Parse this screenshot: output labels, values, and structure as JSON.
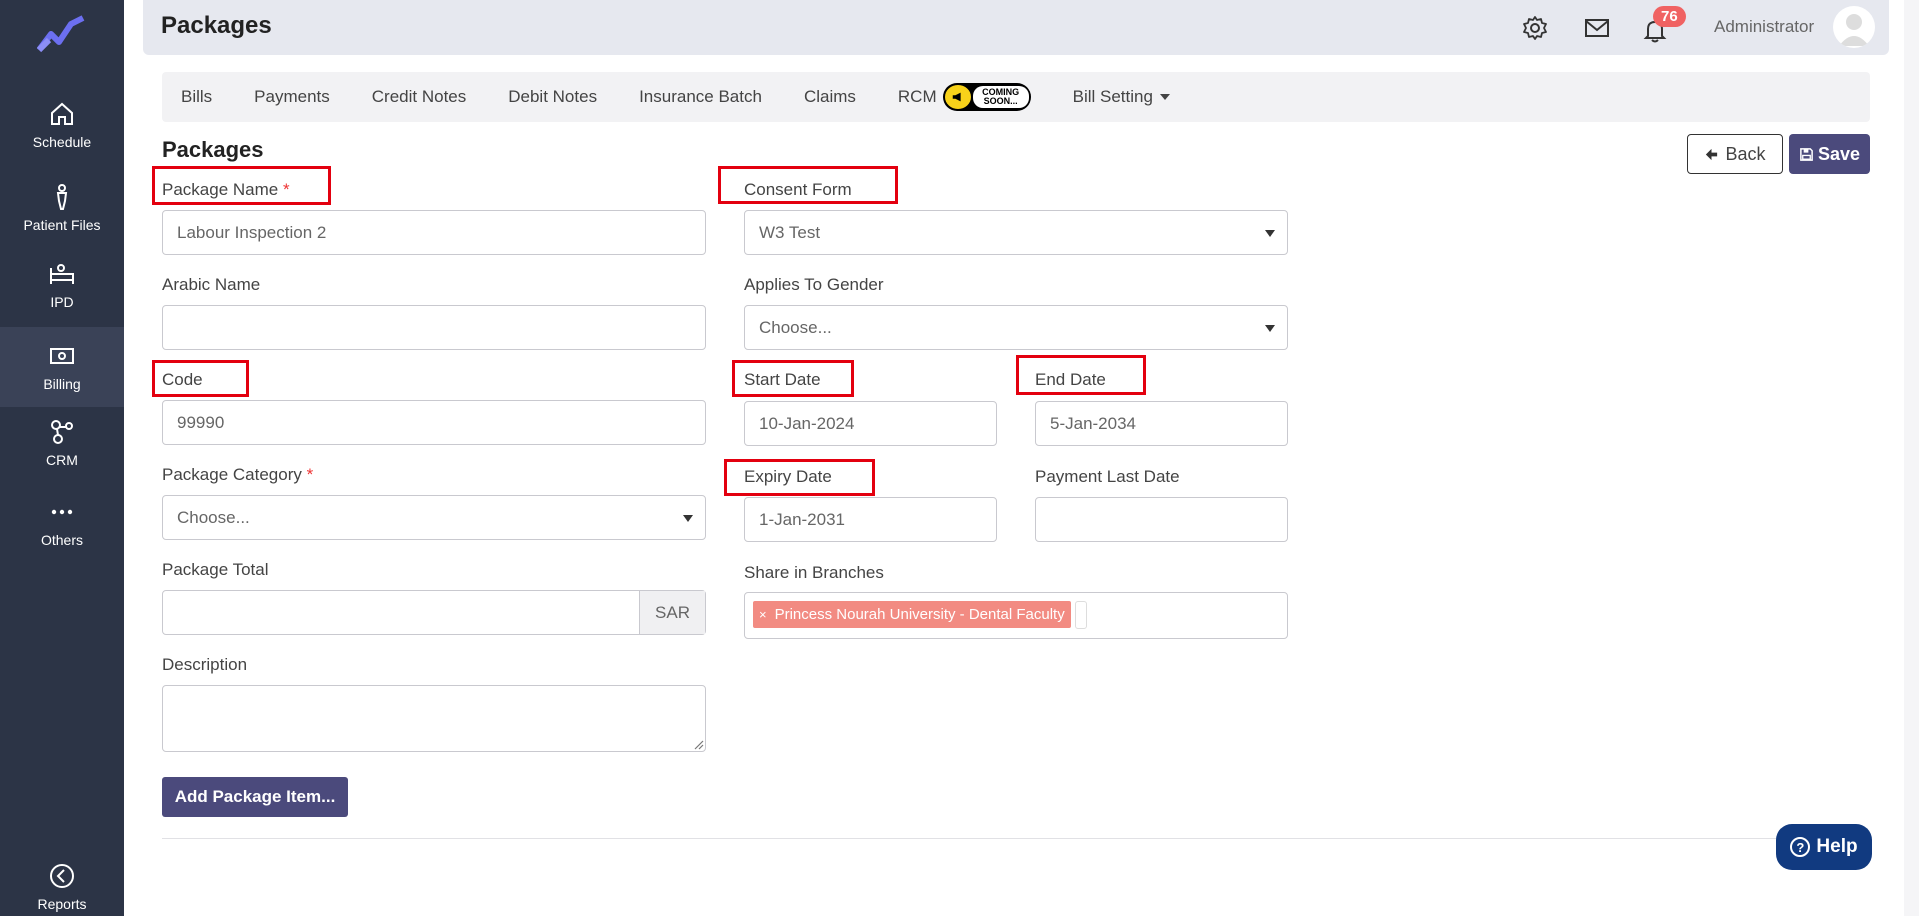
{
  "sidebar": {
    "items": [
      {
        "label": "Schedule",
        "icon": "home-icon"
      },
      {
        "label": "Patient Files",
        "icon": "person-icon"
      },
      {
        "label": "IPD",
        "icon": "bed-icon"
      },
      {
        "label": "Billing",
        "icon": "money-icon",
        "active": true
      },
      {
        "label": "CRM",
        "icon": "crm-icon"
      },
      {
        "label": "Others",
        "icon": "dots-icon"
      },
      {
        "label": "Reports",
        "icon": "reports-icon"
      }
    ]
  },
  "header": {
    "title": "Packages",
    "notification_count": "76",
    "user_name": "Administrator"
  },
  "tabs": [
    {
      "label": "Bills"
    },
    {
      "label": "Payments"
    },
    {
      "label": "Credit Notes"
    },
    {
      "label": "Debit Notes"
    },
    {
      "label": "Insurance Batch"
    },
    {
      "label": "Claims"
    },
    {
      "label": "RCM"
    },
    {
      "label": "Bill Setting"
    }
  ],
  "coming_soon": {
    "line1": "COMING",
    "line2": "SOON..."
  },
  "form": {
    "title": "Packages",
    "back_label": "Back",
    "save_label": "Save",
    "package_name": {
      "label": "Package Name",
      "required": "*",
      "value": "Labour Inspection 2"
    },
    "arabic_name": {
      "label": "Arabic Name",
      "value": ""
    },
    "code": {
      "label": "Code",
      "value": "99990"
    },
    "package_category": {
      "label": "Package Category",
      "required": "*",
      "value": "Choose..."
    },
    "package_total": {
      "label": "Package Total",
      "value": "",
      "currency": "SAR"
    },
    "description": {
      "label": "Description",
      "value": ""
    },
    "consent_form": {
      "label": "Consent Form",
      "value": "W3 Test"
    },
    "applies_to_gender": {
      "label": "Applies To Gender",
      "value": "Choose..."
    },
    "start_date": {
      "label": "Start Date",
      "value": "10-Jan-2024"
    },
    "end_date": {
      "label": "End Date",
      "value": "5-Jan-2034"
    },
    "expiry_date": {
      "label": "Expiry Date",
      "value": "1-Jan-2031"
    },
    "payment_last_date": {
      "label": "Payment Last Date",
      "value": ""
    },
    "share_in_branches": {
      "label": "Share in Branches",
      "tag_remove": "×",
      "tags": [
        "Princess Nourah University - Dental Faculty"
      ]
    },
    "add_item_label": "Add Package Item..."
  },
  "help": {
    "label": "Help",
    "glyph": "?"
  },
  "colors": {
    "sidebar": "#2c3446",
    "primary_button": "#4b4a7c",
    "highlight": "#e3000f",
    "tag": "#f28b82",
    "help": "#113a80"
  }
}
